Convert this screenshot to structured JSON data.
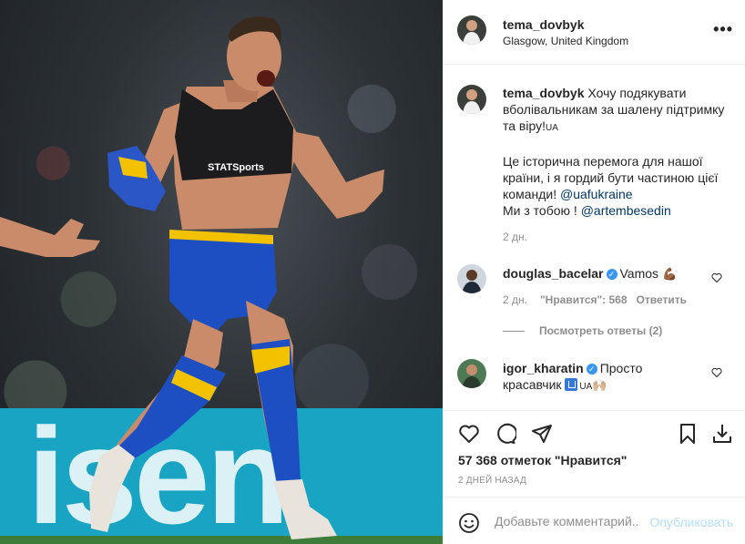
{
  "photo": {
    "board_text": "isen",
    "board_color": "#1aa4c4",
    "kit_blue": "#1e4fc2",
    "kit_yellow": "#f2c200"
  },
  "header": {
    "username": "tema_dovbyk",
    "location": "Glasgow, United Kingdom",
    "more_icon": "more-dots-icon",
    "more_label": "•••"
  },
  "caption": {
    "username": "tema_dovbyk",
    "text": "Хочу подякувати вболівальникам за шалену підтримку та віру!",
    "flag": "UA",
    "text2": "Це історична перемога для нашої країни, і я гордий бути частиною цієї команди!",
    "mention1": "@uafukraine",
    "text3": "Ми з тобою !",
    "mention2": "@artembesedin",
    "time": "2 дн."
  },
  "comments": [
    {
      "username": "douglas_bacelar",
      "verified": true,
      "text": "Vamos",
      "emoji": "💪🏾",
      "time": "2 дн.",
      "likes": "\"Нравится\": 568",
      "reply": "Ответить",
      "view_replies": "Посмотреть ответы (2)"
    },
    {
      "username": "igor_kharatin",
      "verified": true,
      "text": "Просто красавчик",
      "flag": "UA",
      "emoji": "🙌🏼"
    }
  ],
  "actions": {
    "like_icon": "heart-icon",
    "comment_icon": "comment-icon",
    "share_icon": "share-icon",
    "save_icon": "bookmark-icon",
    "download_icon": "download-icon",
    "likes": "57 368 отметок \"Нравится\"",
    "date": "2 ДНЕЙ НАЗАД"
  },
  "add_comment": {
    "placeholder": "Добавьте комментарий...",
    "post_label": "Опубликовать",
    "emoji_icon": "smile-icon"
  },
  "colors": {
    "link": "#00376b",
    "verified": "#3897f0",
    "post_disabled": "#b2dffc",
    "muted": "#8e8e8e"
  }
}
